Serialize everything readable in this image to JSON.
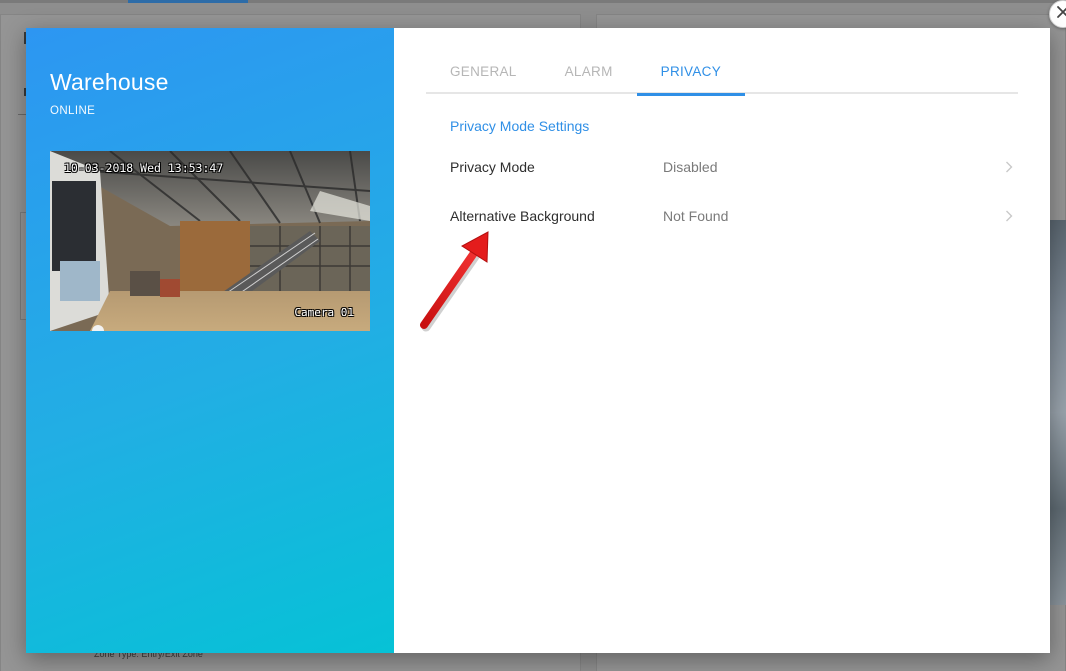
{
  "background": {
    "zone_text": "Zone Type: Entry/Exit Zone"
  },
  "camera": {
    "name": "Warehouse",
    "status": "ONLINE",
    "osd_timestamp": "10-03-2018 Wed 13:53:47",
    "osd_label": "Camera 01"
  },
  "tabs": [
    {
      "label": "GENERAL",
      "active": false
    },
    {
      "label": "ALARM",
      "active": false
    },
    {
      "label": "PRIVACY",
      "active": true
    }
  ],
  "privacy": {
    "section_title": "Privacy Mode Settings",
    "settings": [
      {
        "label": "Privacy Mode",
        "value": "Disabled",
        "icon": "chevron-right-icon"
      },
      {
        "label": "Alternative Background",
        "value": "Not Found",
        "icon": "chevron-right-icon"
      }
    ]
  },
  "colors": {
    "accent": "#2f8fe6",
    "panel_gradient_start": "#2d96f2",
    "panel_gradient_end": "#06c2d6",
    "annotation_arrow": "#e41c1c"
  }
}
